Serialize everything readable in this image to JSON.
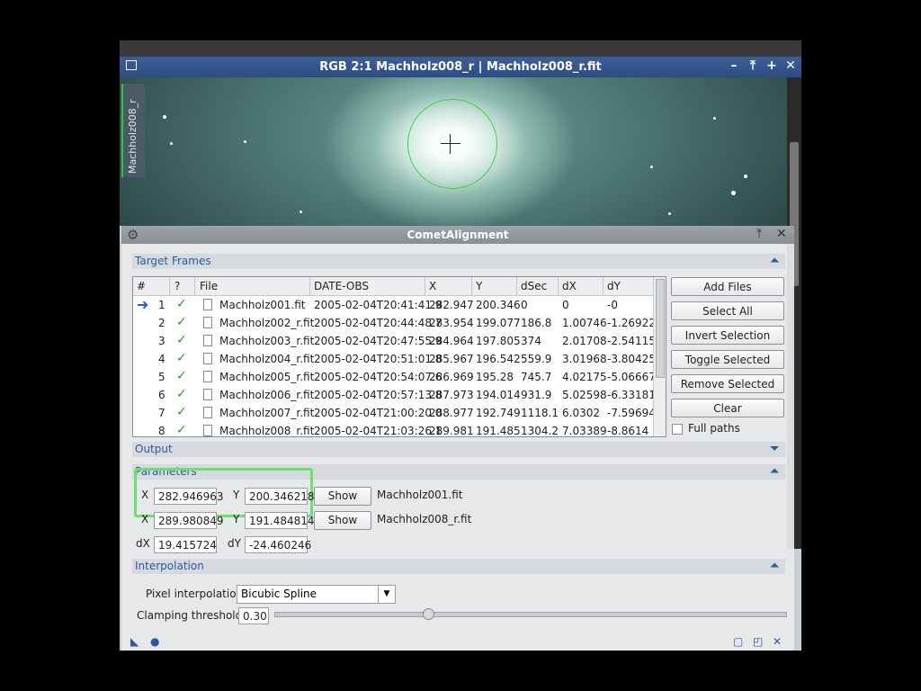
{
  "window": {
    "title": "RGB 2:1 Machholz008_r | Machholz008_r.fit",
    "view_tab": "Machholz008_r",
    "buttons": [
      "–",
      "⤒",
      "+",
      "✕"
    ]
  },
  "dialog": {
    "title": "CometAlignment",
    "sections": {
      "target_frames": "Target Frames",
      "output": "Output",
      "parameters": "Parameters",
      "interpolation": "Interpolation"
    },
    "table": {
      "columns": [
        "#",
        "?",
        "File",
        "DATE-OBS",
        "X",
        "Y",
        "dSec",
        "dX",
        "dY"
      ],
      "rows": [
        {
          "n": "1",
          "file": "Machholz001.fit",
          "date": "2005-02-04T20:41:41.9",
          "x": "282.947",
          "y": "200.346",
          "dsec": "0",
          "dx": "0",
          "dy": "-0"
        },
        {
          "n": "2",
          "file": "Machholz002_r.fit",
          "date": "2005-02-04T20:44:48.7",
          "x": "283.954",
          "y": "199.077",
          "dsec": "186.8",
          "dx": "1.00746",
          "dy": "-1.26922"
        },
        {
          "n": "3",
          "file": "Machholz003_r.fit",
          "date": "2005-02-04T20:47:55.9",
          "x": "284.964",
          "y": "197.805",
          "dsec": "374",
          "dx": "2.01708",
          "dy": "-2.54115"
        },
        {
          "n": "4",
          "file": "Machholz004_r.fit",
          "date": "2005-02-04T20:51:01.8",
          "x": "285.967",
          "y": "196.542",
          "dsec": "559.9",
          "dx": "3.01968",
          "dy": "-3.80425"
        },
        {
          "n": "5",
          "file": "Machholz005_r.fit",
          "date": "2005-02-04T20:54:07.6",
          "x": "286.969",
          "y": "195.28",
          "dsec": "745.7",
          "dx": "4.02175",
          "dy": "-5.06667"
        },
        {
          "n": "6",
          "file": "Machholz006_r.fit",
          "date": "2005-02-04T20:57:13.8",
          "x": "287.973",
          "y": "194.014",
          "dsec": "931.9",
          "dx": "5.02598",
          "dy": "-6.33181"
        },
        {
          "n": "7",
          "file": "Machholz007_r.fit",
          "date": "2005-02-04T21:00:20.0",
          "x": "288.977",
          "y": "192.749",
          "dsec": "1118.1",
          "dx": "6.0302",
          "dy": "-7.59694"
        },
        {
          "n": "8",
          "file": "Machholz008_r.fit",
          "date": "2005-02-04T21:03:26.1",
          "x": "289.981",
          "y": "191.485",
          "dsec": "1304.2",
          "dx": "7.03389",
          "dy": "-8.8614"
        }
      ]
    },
    "side_buttons": {
      "add_files": "Add Files",
      "select_all": "Select All",
      "invert_selection": "Invert Selection",
      "toggle_selected": "Toggle Selected",
      "remove_selected": "Remove Selected",
      "clear": "Clear",
      "full_paths": "Full paths"
    },
    "parameters": {
      "x_label": "X",
      "y_label": "Y",
      "first": {
        "x": "282.946963",
        "y": "200.346218",
        "file": "Machholz001.fit"
      },
      "last": {
        "x": "289.980849",
        "y": "191.484814",
        "file": "Machholz008_r.fit"
      },
      "show": "Show",
      "dx_label": "dX",
      "dy_label": "dY",
      "dx": "19.415724",
      "dy": "-24.460246"
    },
    "interpolation": {
      "pixel_label": "Pixel interpolation:",
      "pixel_value": "Bicubic Spline",
      "clamp_label": "Clamping threshold:",
      "clamp_value": "0.30",
      "clamp_fraction": 0.3
    }
  }
}
